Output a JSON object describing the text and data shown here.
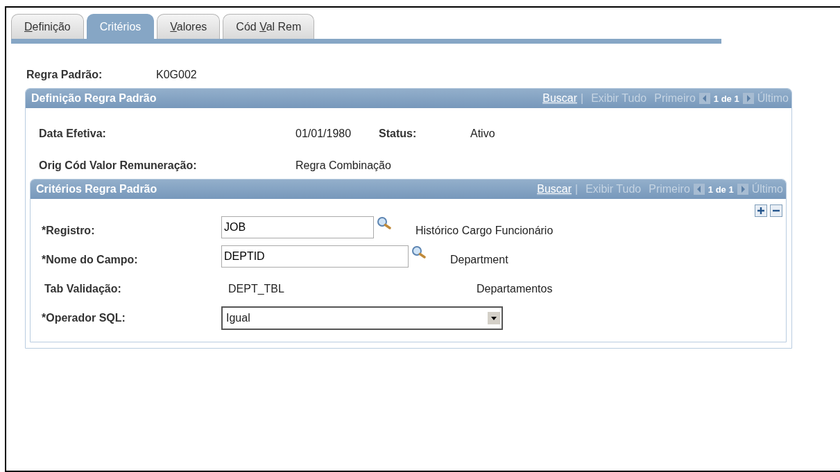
{
  "tabs": [
    {
      "key": "D",
      "post": "efinição",
      "selected": false
    },
    {
      "post": "Critérios",
      "selected": true
    },
    {
      "key": "V",
      "post": "alores",
      "selected": false
    },
    {
      "pre": "Cód ",
      "key": "V",
      "post": "al Rem",
      "selected": false
    }
  ],
  "header": {
    "label": "Regra Padrão:",
    "value": "K0G002"
  },
  "outer_group": {
    "title": "Definição Regra Padrão",
    "nav": {
      "find": "Buscar",
      "separator": "|",
      "view_all": "Exibir Tudo",
      "first": "Primeiro",
      "count": "1 de 1",
      "last": "Último"
    },
    "effective_date": {
      "label": "Data Efetiva:",
      "value": "01/01/1980"
    },
    "status": {
      "label": "Status:",
      "value": "Ativo"
    },
    "source": {
      "label": "Orig Cód Valor Remuneração:",
      "value": "Regra Combinação"
    }
  },
  "inner_group": {
    "title": "Critérios Regra Padrão",
    "nav": {
      "find": "Buscar",
      "separator": "|",
      "view_all": "Exibir Tudo",
      "first": "Primeiro",
      "count": "1 de 1",
      "last": "Último"
    },
    "rows": [
      {
        "kind": "lookup",
        "label": "*Registro:",
        "value": "JOB",
        "description": "Histórico Cargo Funcionário"
      },
      {
        "kind": "lookup",
        "label": "*Nome do Campo:",
        "value": "DEPTID",
        "description": "Department"
      },
      {
        "kind": "readonly",
        "label": "Tab Validação:",
        "value": "DEPT_TBL",
        "description": "Departamentos"
      },
      {
        "kind": "select",
        "label": "*Operador SQL:",
        "value": "Igual"
      }
    ]
  }
}
